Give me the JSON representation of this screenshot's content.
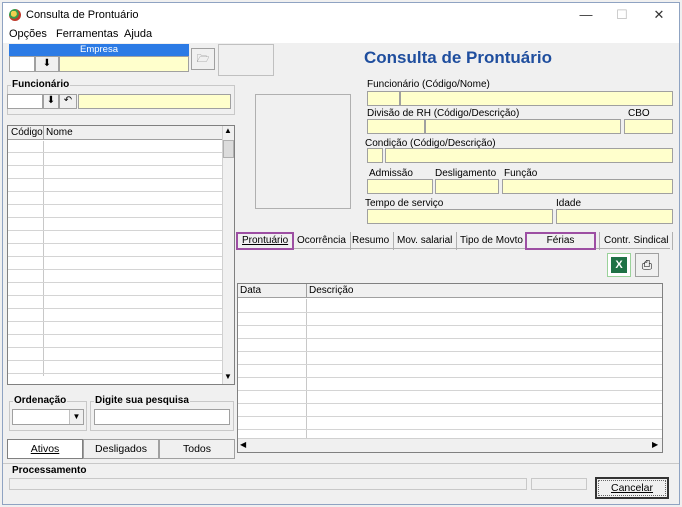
{
  "window": {
    "title": "Consulta de Prontuário"
  },
  "menu": [
    "Opções",
    "Ferramentas",
    "Ajuda"
  ],
  "header": {
    "empresa_label": "Empresa",
    "page_title": "Consulta de Prontuário",
    "accent_color": "#1f4e9e"
  },
  "funcionario_panel": {
    "label": "Funcionário",
    "grid_columns": [
      "Código",
      "Nome"
    ]
  },
  "details": {
    "funcionario_label": "Funcionário (Código/Nome)",
    "divisao_label": "Divisão de RH (Código/Descrição)",
    "cbo_label": "CBO",
    "condicao_label": "Condição (Código/Descrição)",
    "admissao_label": "Admissão",
    "desligamento_label": "Desligamento",
    "funcao_label": "Função",
    "tempo_label": "Tempo de serviço",
    "idade_label": "Idade"
  },
  "tabs": [
    "Prontuário",
    "Ocorrência",
    "Resumo",
    "Mov. salarial",
    "Tipo de Movto",
    "Férias",
    "Contr. Sindical"
  ],
  "history_grid": {
    "columns": [
      "Data",
      "Descrição"
    ]
  },
  "search": {
    "ordenacao_label": "Ordenação",
    "pesquisa_label": "Digite sua pesquisa"
  },
  "filters": [
    "Ativos",
    "Desligados",
    "Todos"
  ],
  "footer": {
    "processamento_label": "Processamento",
    "cancel_label": "Cancelar"
  }
}
